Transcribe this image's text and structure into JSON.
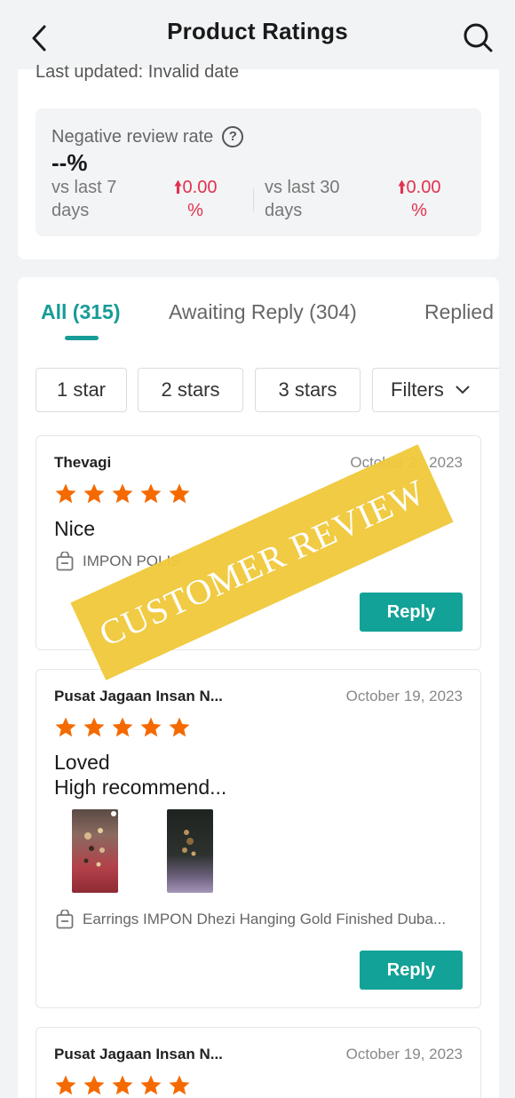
{
  "header": {
    "title": "Product Ratings"
  },
  "summary": {
    "last_updated": "Last updated: Invalid date",
    "negative_review_rate_label": "Negative review rate",
    "negative_review_rate_value": "--%",
    "vs_last_7_label_1": "vs last 7",
    "vs_last_7_label_2": "days",
    "vs_last_7_delta_1": "0.00",
    "vs_last_7_delta_2": "%",
    "vs_last_30_label_1": "vs last 30",
    "vs_last_30_label_2": "days",
    "vs_last_30_delta_1": "0.00",
    "vs_last_30_delta_2": "%"
  },
  "tabs": [
    {
      "label": "All (315)",
      "active": true
    },
    {
      "label": "Awaiting Reply (304)",
      "active": false
    },
    {
      "label": "Replied",
      "active": false
    }
  ],
  "filters": {
    "chips": [
      "1 star",
      "2 stars",
      "3 stars"
    ],
    "filters_label": "Filters"
  },
  "reviews": [
    {
      "name": "Thevagi",
      "date": "October 2",
      "date_tail": "2023",
      "rating": 5,
      "text_line1": "Nice",
      "text_line2": "",
      "product": "IMPON POLIS",
      "reply_label": "Reply"
    },
    {
      "name": "Pusat Jagaan Insan N...",
      "date": "October 19, 2023",
      "rating": 5,
      "text_line1": "Loved",
      "text_line2": "High recommend...",
      "product": "Earrings IMPON Dhezi Hanging Gold Finished Duba...",
      "reply_label": "Reply"
    },
    {
      "name": "Pusat Jagaan Insan N...",
      "date": "October 19, 2023",
      "rating": 5
    }
  ],
  "watermark": "CUSTOMER REVIEW",
  "colors": {
    "accent": "#179c97",
    "reply_button": "#13a297",
    "star": "#f56a00",
    "delta_red": "#e0324e",
    "stamp": "#f0c93c"
  }
}
